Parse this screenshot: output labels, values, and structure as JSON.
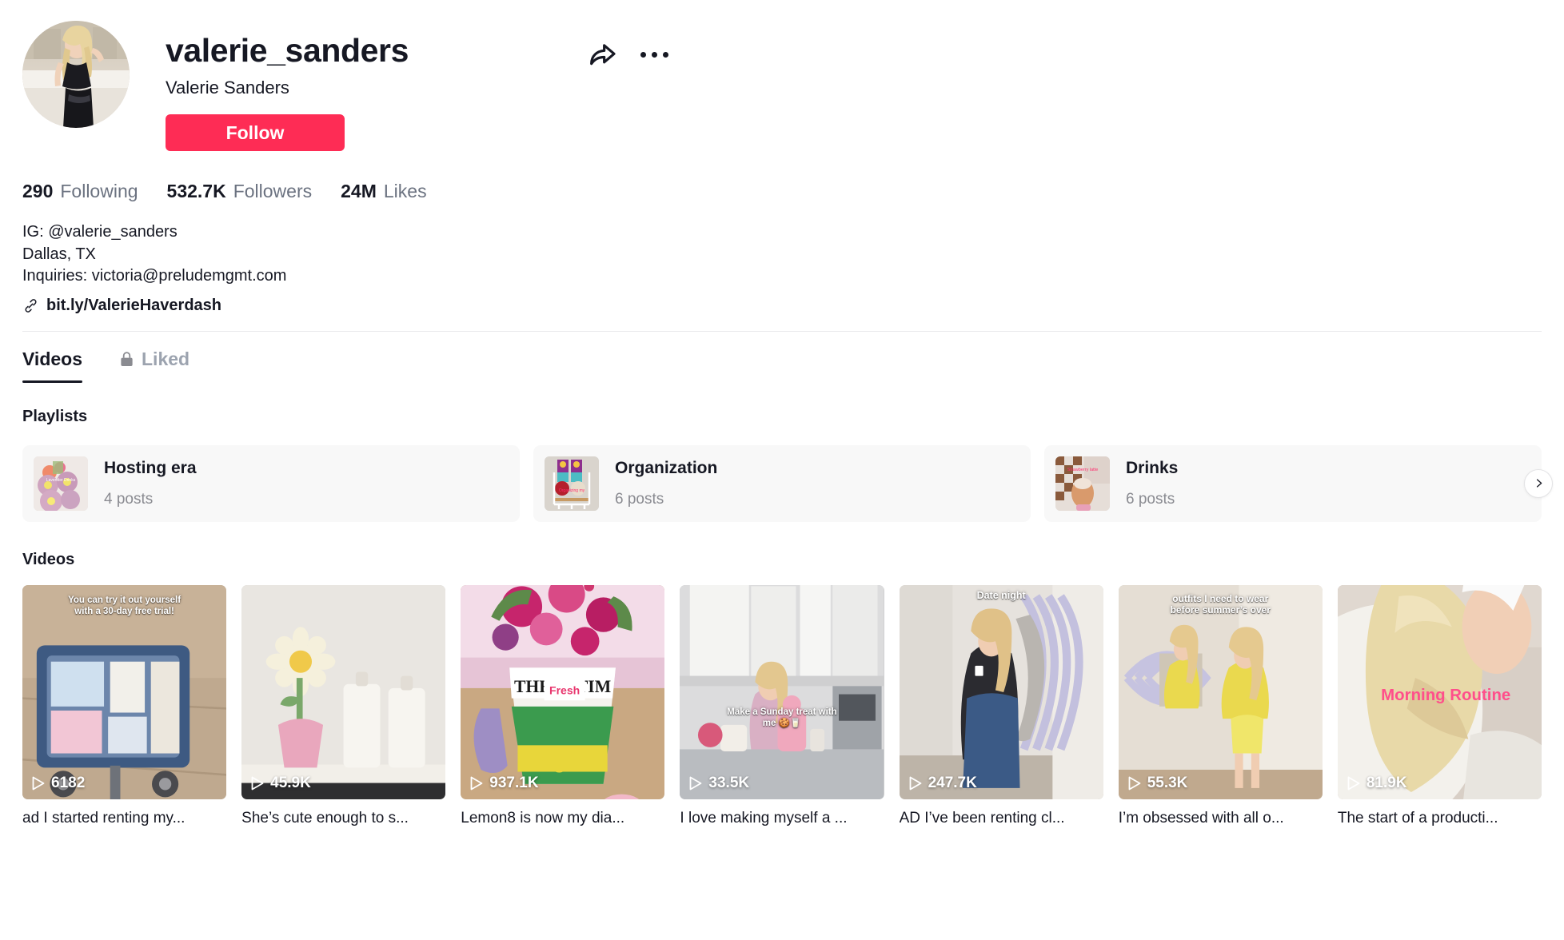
{
  "profile": {
    "username": "valerie_sanders",
    "display_name": "Valerie Sanders",
    "follow_label": "Follow",
    "avatar_alt": "valerie-sanders-avatar",
    "share_icon": "share-icon",
    "more_icon": "more-options-icon"
  },
  "stats": [
    {
      "num": "290",
      "label": "Following"
    },
    {
      "num": "532.7K",
      "label": "Followers"
    },
    {
      "num": "24M",
      "label": "Likes"
    }
  ],
  "bio": {
    "lines": [
      "IG: @valerie_sanders",
      "Dallas, TX",
      "Inquiries: victoria@preludemgmt.com"
    ],
    "link": "bit.ly/ValerieHaverdash",
    "link_icon": "link-icon"
  },
  "tabs": [
    {
      "label": "Videos",
      "active": true,
      "icon": null
    },
    {
      "label": "Liked",
      "active": false,
      "icon": "lock-icon"
    }
  ],
  "sections": {
    "playlists_title": "Playlists",
    "videos_title": "Videos"
  },
  "playlists": [
    {
      "name": "Hosting era",
      "count": "4 posts",
      "thumb_label": "Lavender Drinks"
    },
    {
      "name": "Organization",
      "count": "6 posts",
      "thumb_label": "Organizing my apartment"
    },
    {
      "name": "Drinks",
      "count": "6 posts",
      "thumb_label": "Strawberry latte"
    }
  ],
  "carousel": {
    "next_icon": "chevron-right-icon"
  },
  "videos": [
    {
      "views": "6182",
      "caption": "ad I started renting my...",
      "overlay": "You can try it out yourself\nwith a 30-day free trial!"
    },
    {
      "views": "45.9K",
      "caption": "She’s cute enough to s...",
      "overlay": ""
    },
    {
      "views": "937.1K",
      "caption": "Lemon8 is now my dia...",
      "overlay": ""
    },
    {
      "views": "33.5K",
      "caption": "I love making myself a ...",
      "overlay": "Make a Sunday treat with\nme 🍪🥛"
    },
    {
      "views": "247.7K",
      "caption": "AD I’ve been renting cl...",
      "overlay": "Date night"
    },
    {
      "views": "55.3K",
      "caption": "I’m obsessed with all o...",
      "overlay": "outfits I need to wear\nbefore summer’s over"
    },
    {
      "views": "81.9K",
      "caption": "The start of a producti...",
      "overlay": "Morning Routine"
    }
  ],
  "colors": {
    "accent": "#FE2C55",
    "text": "#161823",
    "muted": "#6B7280",
    "card_bg": "#F8F8F8"
  }
}
